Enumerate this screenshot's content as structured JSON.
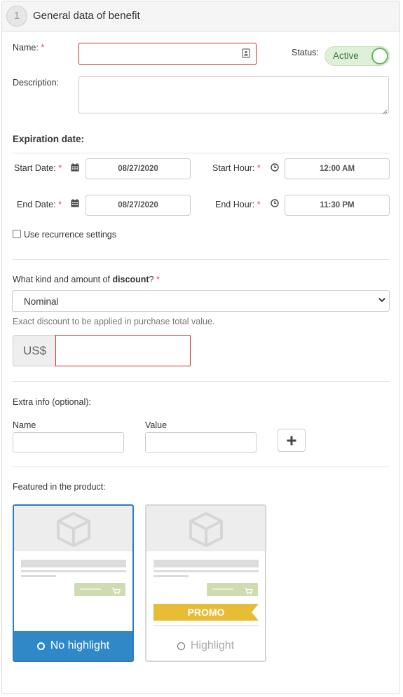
{
  "header": {
    "step": "1",
    "title": "General data of benefit"
  },
  "form": {
    "name_label": "Name:",
    "required_mark": "*",
    "name_value": "",
    "status_label": "Status:",
    "status_toggle": "Active",
    "description_label": "Description:",
    "description_value": ""
  },
  "expiration": {
    "heading": "Expiration date:",
    "start_date_label": "Start Date:",
    "start_date": "08/27/2020",
    "start_hour_label": "Start Hour:",
    "start_hour": "12:00 AM",
    "end_date_label": "End Date:",
    "end_date": "08/27/2020",
    "end_hour_label": "End Hour:",
    "end_hour": "11:30 PM",
    "recurrence_label": "Use recurrence settings"
  },
  "discount": {
    "question_prefix": "What kind and amount of ",
    "question_bold": "discount",
    "question_suffix": "?",
    "selected": "Nominal",
    "help": "Exact discount to be applied in purchase total value.",
    "currency": "US$",
    "amount": ""
  },
  "extra": {
    "heading": "Extra info (optional):",
    "name_label": "Name",
    "value_label": "Value",
    "name_value": "",
    "value_value": ""
  },
  "featured": {
    "heading": "Featured in the product:",
    "promo_label": "PROMO",
    "options": [
      {
        "label": "No highlight",
        "selected": true
      },
      {
        "label": "Highlight",
        "selected": false
      }
    ]
  },
  "colors": {
    "accent": "#2f89c8",
    "required": "#d9534f",
    "active_green": "#5cb85c",
    "promo": "#e6bd34"
  }
}
